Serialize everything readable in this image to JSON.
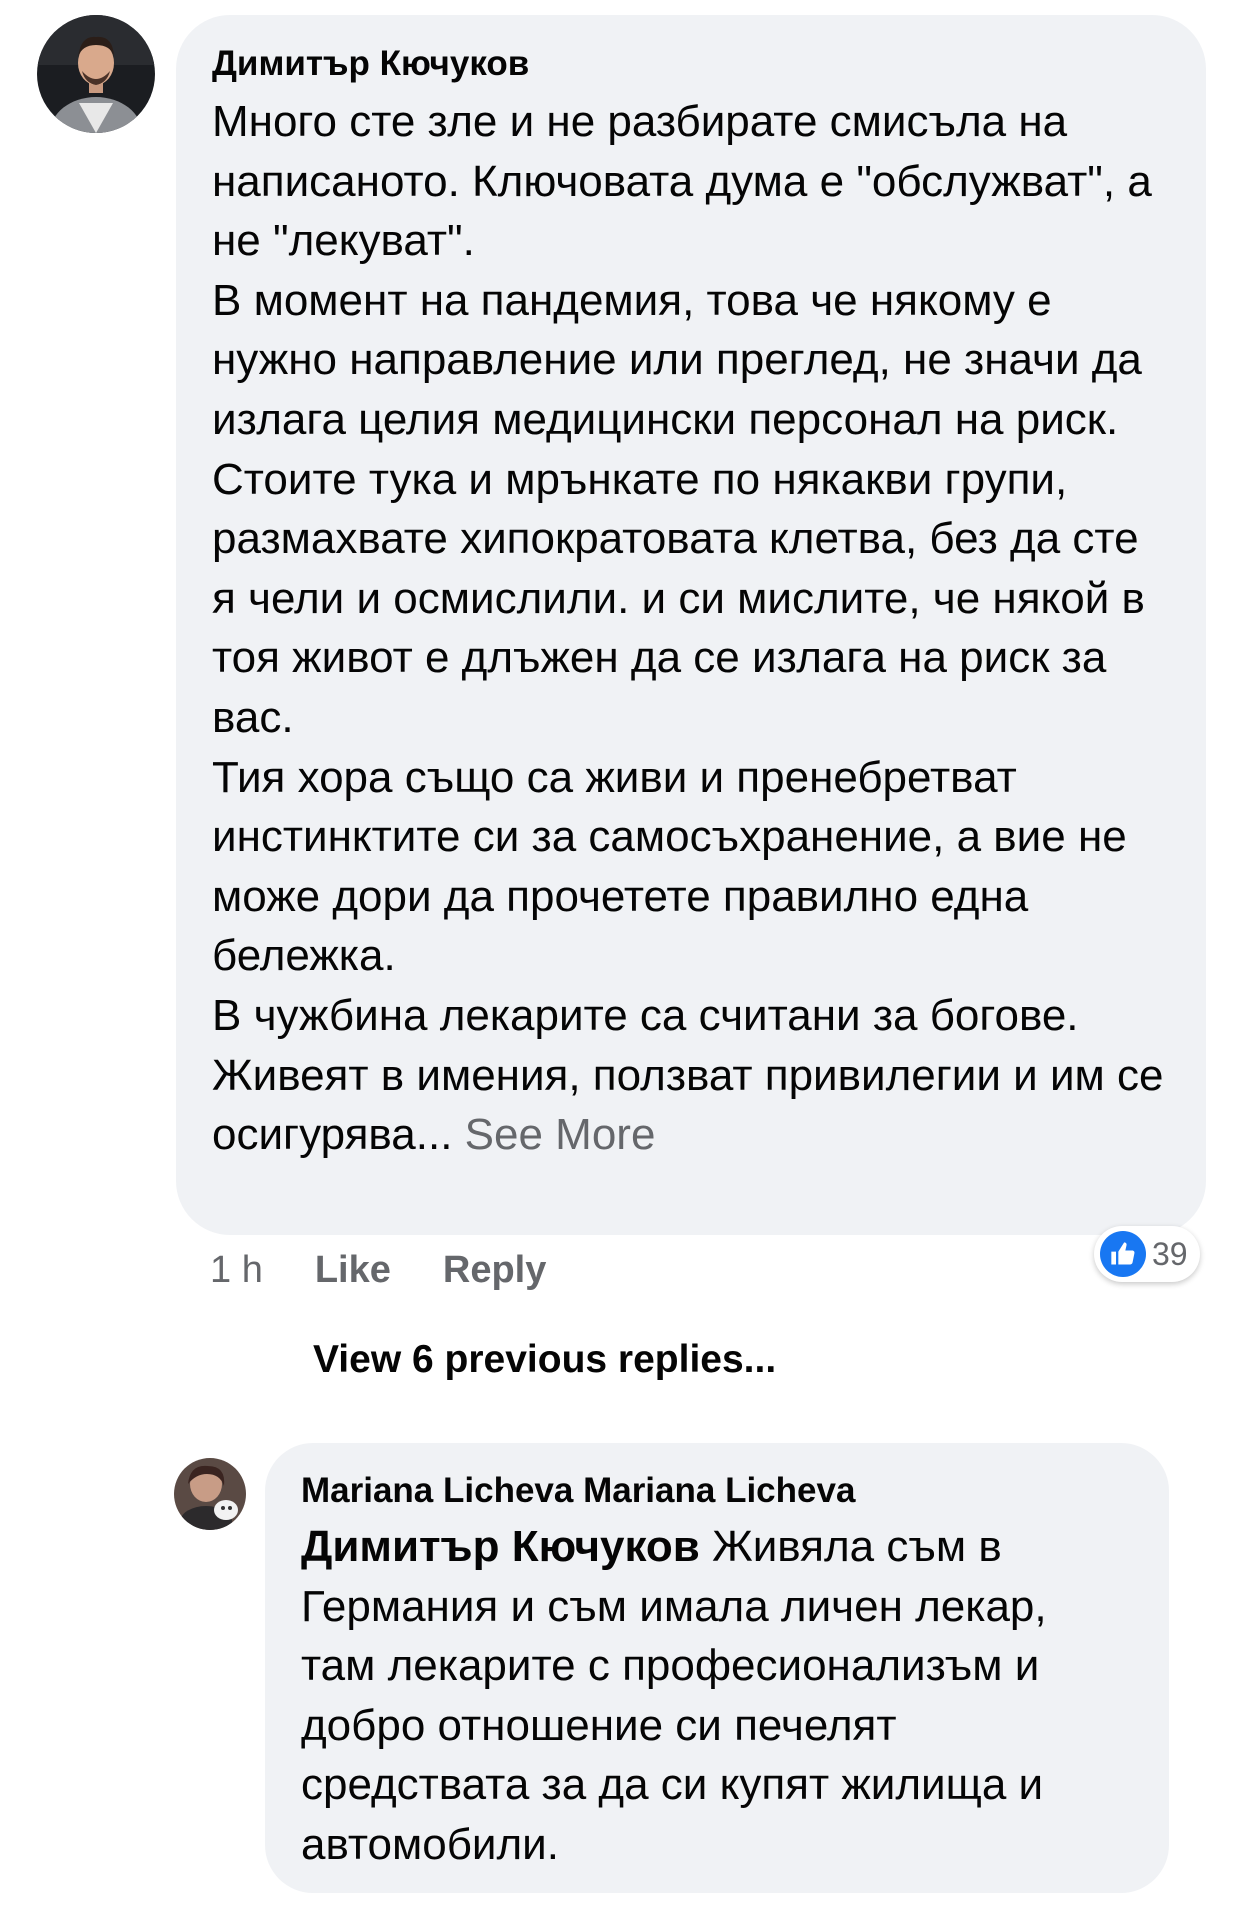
{
  "comment": {
    "author": "Димитър Кючуков",
    "paragraphs": [
      "Много сте зле и не разбирате смисъла на написаното. Ключовата дума е \"обслужват\", а не \"лекуват\".",
      "В момент на пандемия, това че някому  е нужно направление или преглед, не значи да излага целия медицински персонал на риск. Стоите тука и мрънкате по някакви групи, размахвате хипократовата клетва, без да сте я чели и осмислили. и си мислите, че някой в тоя живот е длъжен да се излага на риск за вас.",
      "Тия хора също са живи и пренебретват инстинктите си за самосъхранение, а вие не може дори да прочетете правилно една бележка.",
      "В чужбина лекарите са считани за богове. Живеят в имения, ползват привилегии и им се осигурява... "
    ],
    "see_more_label": "See More",
    "time": "1 h",
    "like_label": "Like",
    "reply_label": "Reply",
    "reaction_count": "39",
    "reaction_icon": "thumbs-up-icon",
    "reaction_color": "#1877f2"
  },
  "view_replies_label": "View 6 previous replies...",
  "reply": {
    "author": "Mariana Licheva Mariana Licheva",
    "mention": "Димитър Кючуков",
    "text": " Живяла съм в Германия и съм имала личен лекар, там лекарите с професионализъм и добро отношение си печелят средствата за да си купят жилища и автомобили."
  }
}
